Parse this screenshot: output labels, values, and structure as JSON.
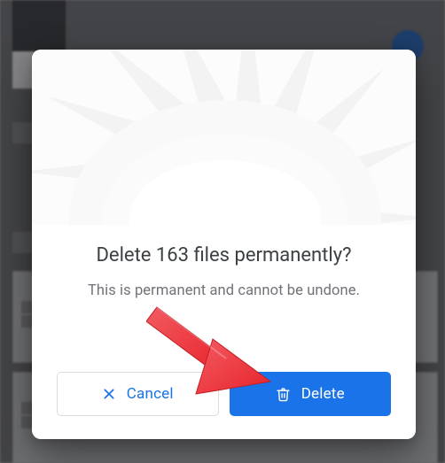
{
  "dialog": {
    "title": "Delete 163 files permanently?",
    "subtitle": "This is permanent and cannot be undone.",
    "cancel_label": "Cancel",
    "delete_label": "Delete"
  },
  "colors": {
    "primary": "#1a73e8",
    "text": "#3c4043",
    "muted": "#6f7378",
    "border": "#dadce0"
  },
  "annotation": {
    "arrow_color": "#ee3c43"
  }
}
